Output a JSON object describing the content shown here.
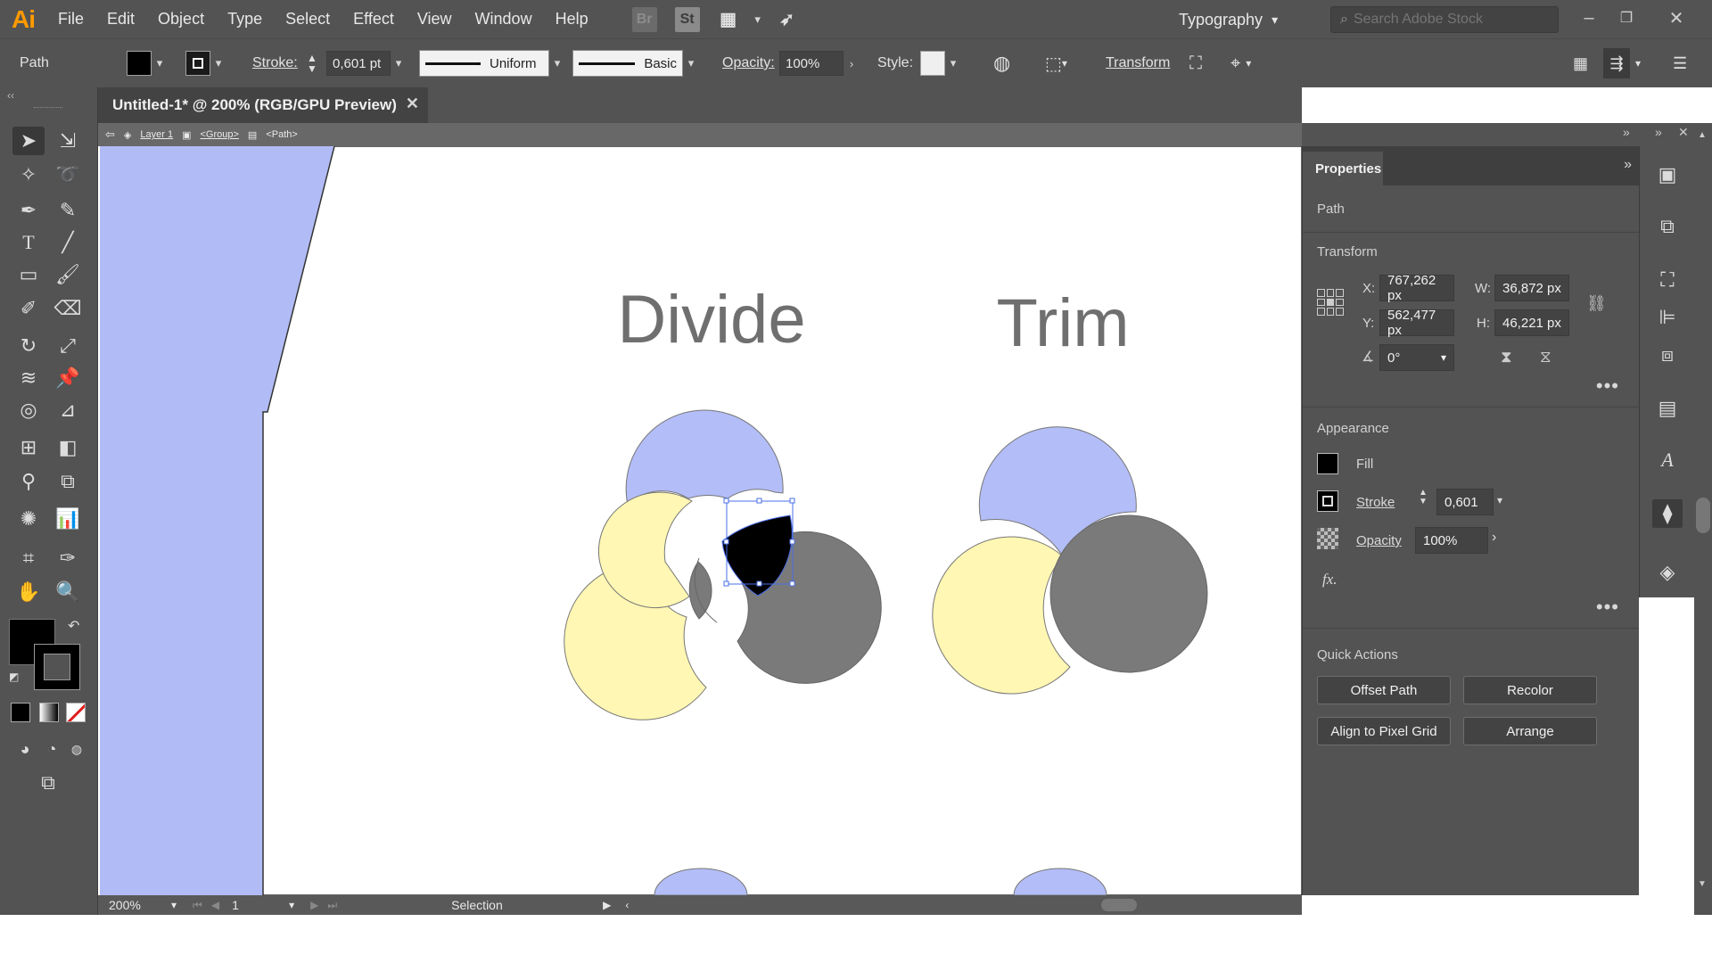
{
  "app": {
    "logo": "Ai"
  },
  "menu": [
    "File",
    "Edit",
    "Object",
    "Type",
    "Select",
    "Effect",
    "View",
    "Window",
    "Help"
  ],
  "menu_icons": {
    "bridge": "Br",
    "stock": "St"
  },
  "workspace": "Typography",
  "stock_search": {
    "placeholder": "Search Adobe Stock"
  },
  "control_bar": {
    "selection_type": "Path",
    "stroke_label": "Stroke:",
    "stroke_weight": "0,601 pt",
    "variable_width": "Uniform",
    "brush": "Basic",
    "opacity_label": "Opacity:",
    "opacity": "100%",
    "style_label": "Style:",
    "transform_link": "Transform"
  },
  "document": {
    "tab_title": "Untitled-1* @ 200% (RGB/GPU Preview)",
    "breadcrumb": [
      "Layer 1",
      "<Group>",
      "<Path>"
    ]
  },
  "artboard": {
    "headings": [
      "Divide",
      "Trim"
    ],
    "colors": {
      "blue": "#b3bdf7",
      "yellow": "#fff7b3",
      "gray": "#7a7a7a",
      "selected": "#000000",
      "selection": "#4a6fe8"
    }
  },
  "status_bar": {
    "zoom": "200%",
    "page": "1",
    "tool": "Selection"
  },
  "properties": {
    "tab": "Properties",
    "object_type": "Path",
    "transform": {
      "title": "Transform",
      "x_label": "X:",
      "x": "767,262 px",
      "y_label": "Y:",
      "y": "562,477 px",
      "w_label": "W:",
      "w": "36,872 px",
      "h_label": "H:",
      "h": "46,221 px",
      "angle": "0°"
    },
    "appearance": {
      "title": "Appearance",
      "fill_label": "Fill",
      "stroke_label": "Stroke",
      "stroke_value": "0,601",
      "opacity_label": "Opacity",
      "opacity_value": "100%",
      "fx_label": "fx."
    },
    "quick_actions": {
      "title": "Quick Actions",
      "buttons": [
        "Offset Path",
        "Recolor",
        "Align to Pixel Grid",
        "Arrange"
      ]
    }
  }
}
